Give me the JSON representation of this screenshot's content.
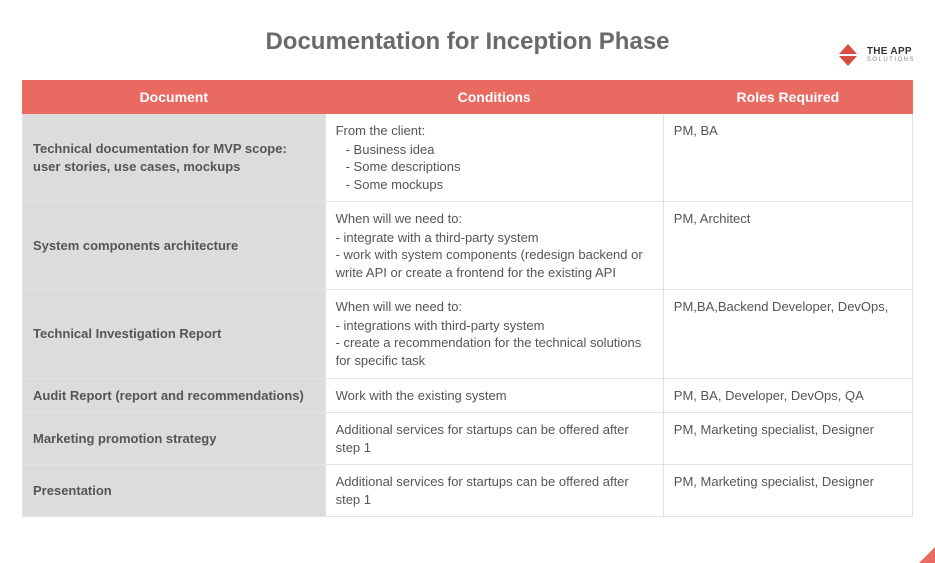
{
  "logo": {
    "line1": "THE APP",
    "line2": "SOLUTIONS"
  },
  "title": "Documentation for Inception Phase",
  "headers": {
    "document": "Document",
    "conditions": "Conditions",
    "roles": "Roles Required"
  },
  "rows": [
    {
      "document": "Technical documentation for MVP scope: user stories, use cases, mockups",
      "conditions_intro": "From the client:",
      "conditions_list": [
        "Business idea",
        "Some descriptions",
        "Some mockups"
      ],
      "roles": "PM, BA"
    },
    {
      "document": "System components architecture",
      "conditions_intro": "When will we need to:",
      "conditions_list": [
        "integrate with a third-party system",
        "work with system components (redesign backend or write API or create a frontend for the existing API"
      ],
      "roles": "PM, Architect"
    },
    {
      "document": "Technical Investigation Report",
      "conditions_intro": "When will we need to:",
      "conditions_list": [
        "integrations with third-party system",
        "create a recommendation for the technical solutions for specific task"
      ],
      "roles": "PM,BA,Backend Developer, DevOps,"
    },
    {
      "document": "Audit Report (report and recommendations)",
      "conditions_text": "Work with the existing system",
      "roles": "PM, BA, Developer, DevOps, QA"
    },
    {
      "document": "Marketing promotion strategy",
      "conditions_text": "Additional services for startups can be offered after step 1",
      "roles": "PM, Marketing specialist, Designer"
    },
    {
      "document": "Presentation",
      "conditions_text": "Additional services for startups can be offered after step 1",
      "roles": "PM, Marketing specialist, Designer"
    }
  ]
}
